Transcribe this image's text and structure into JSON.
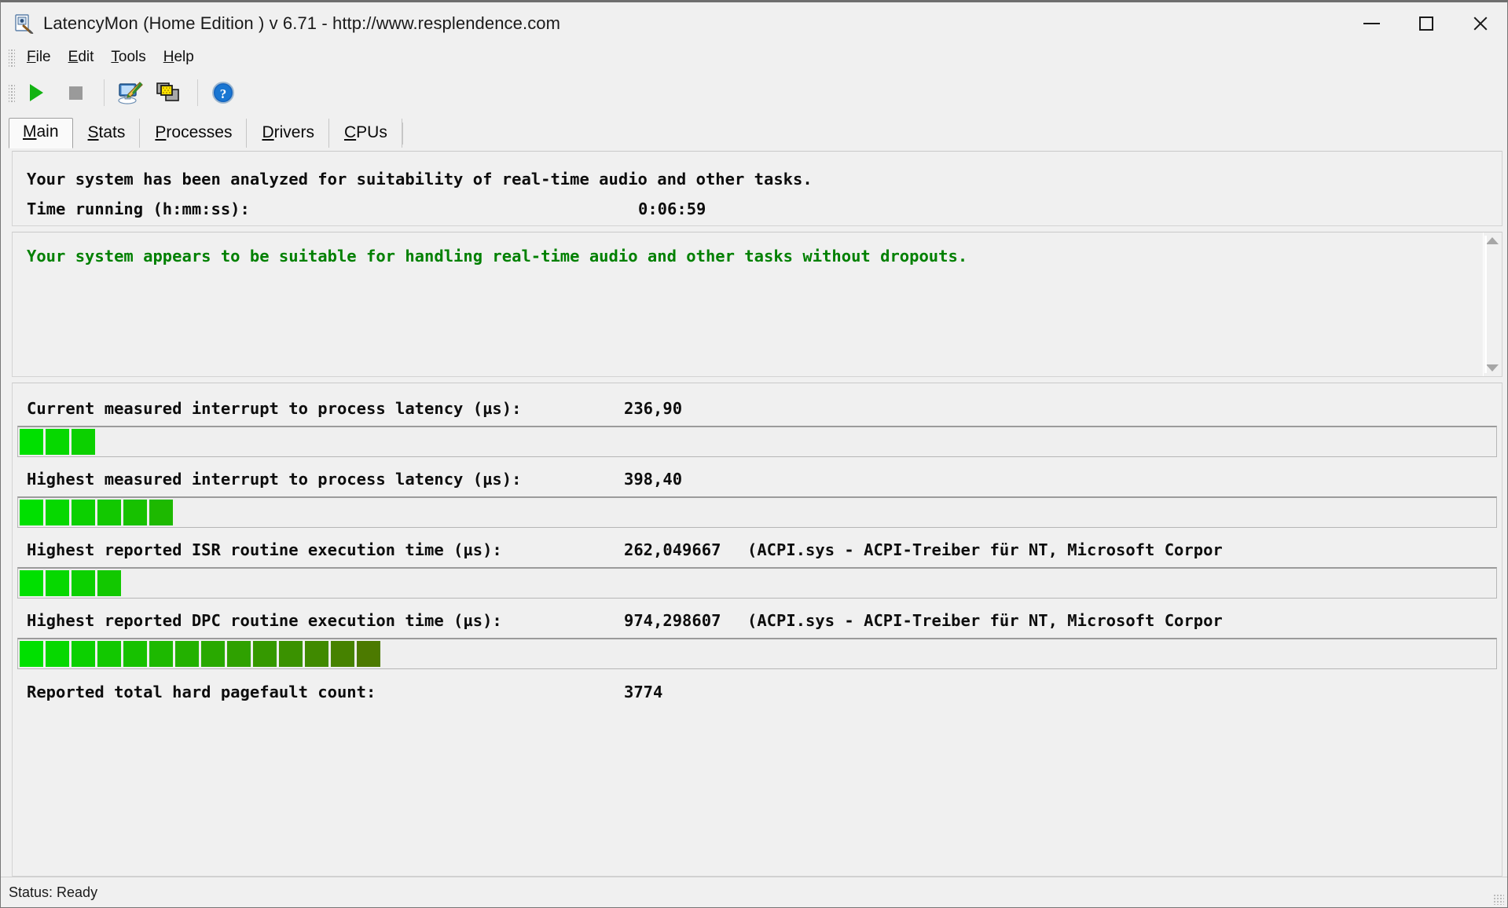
{
  "window": {
    "title": "LatencyMon  (Home Edition )  v 6.71 - http://www.resplendence.com",
    "icon": "latencymon-app-icon",
    "minimize_label": "Minimize",
    "maximize_label": "Maximize",
    "close_label": "Close"
  },
  "menu": {
    "items": [
      {
        "label": "File",
        "accel": "F"
      },
      {
        "label": "Edit",
        "accel": "E"
      },
      {
        "label": "Tools",
        "accel": "T"
      },
      {
        "label": "Help",
        "accel": "H"
      }
    ]
  },
  "toolbar": {
    "buttons": [
      {
        "name": "start-monitoring-button",
        "icon": "play-icon",
        "tip": "Start"
      },
      {
        "name": "stop-monitoring-button",
        "icon": "stop-icon",
        "tip": "Stop"
      },
      {
        "name": "system-info-button",
        "icon": "computer-pen-icon",
        "tip": "System information"
      },
      {
        "name": "copy-report-button",
        "icon": "copy-windows-icon",
        "tip": "Copy report"
      },
      {
        "name": "help-button",
        "icon": "question-mark-icon",
        "tip": "Help"
      }
    ]
  },
  "tabs": [
    {
      "label": "Main",
      "accel": "M",
      "active": true
    },
    {
      "label": "Stats",
      "accel": "S",
      "active": false
    },
    {
      "label": "Processes",
      "accel": "P",
      "active": false
    },
    {
      "label": "Drivers",
      "accel": "D",
      "active": false
    },
    {
      "label": "CPUs",
      "accel": "C",
      "active": false
    }
  ],
  "summary": {
    "headline": "Your system has been analyzed for suitability of real-time audio and other tasks.",
    "time_label": "Time running (h:mm:ss):",
    "time_value": "0:06:59"
  },
  "verdict": {
    "text": "Your system appears to be suitable for handling real-time audio and other tasks without dropouts.",
    "color": "#008000"
  },
  "metrics": [
    {
      "label": "Current measured interrupt to process latency (µs):",
      "value": "236,90",
      "extra": "",
      "segments": 3
    },
    {
      "label": "Highest measured interrupt to process latency (µs):",
      "value": "398,40",
      "extra": "",
      "segments": 6
    },
    {
      "label": "Highest reported ISR routine execution time (µs):",
      "value": "262,049667",
      "extra": "(ACPI.sys - ACPI-Treiber für NT, Microsoft Corpor",
      "segments": 4
    },
    {
      "label": "Highest reported DPC routine execution time (µs):",
      "value": "974,298607",
      "extra": "(ACPI.sys - ACPI-Treiber für NT, Microsoft Corpor",
      "segments": 14
    }
  ],
  "pagefault": {
    "label": "Reported total hard pagefault count:",
    "value": "3774"
  },
  "statusbar": {
    "text": "Status: Ready"
  },
  "colors": {
    "bar_bright": "#00e000",
    "bar_dark": "#4c7a00",
    "verdict_green": "#008000",
    "window_bg": "#f0f0f0",
    "accent_tab": "#fafafa"
  }
}
